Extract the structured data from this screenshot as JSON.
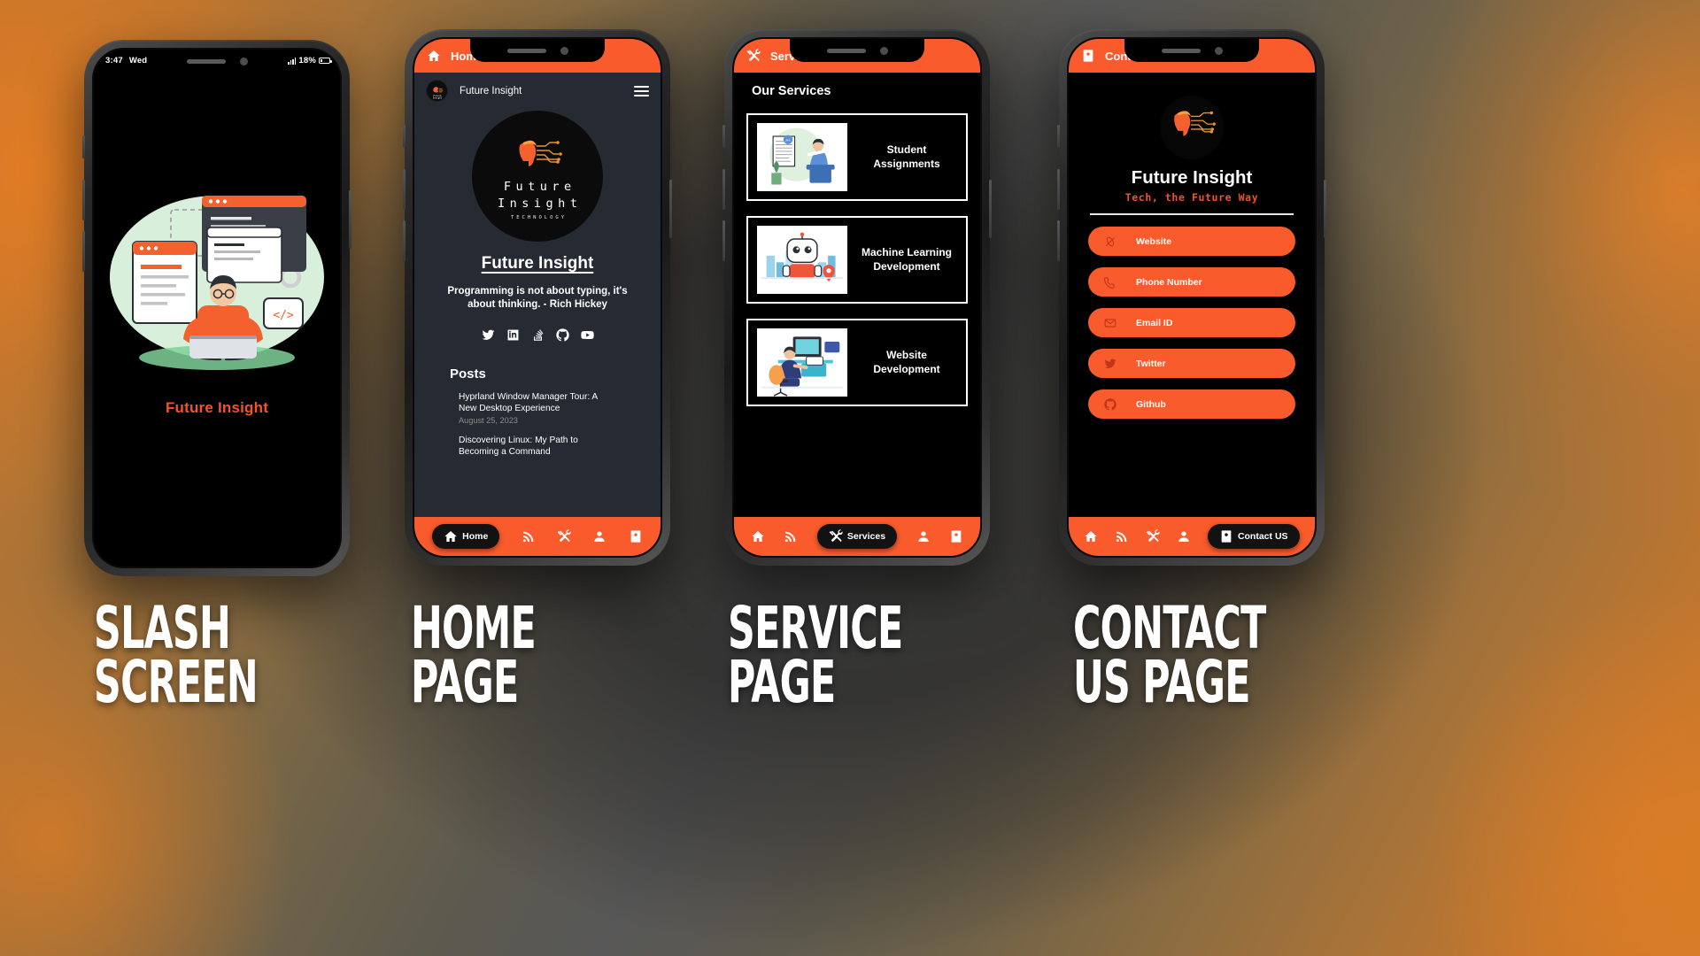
{
  "status_bar": {
    "time": "3:47",
    "day": "Wed",
    "battery": "18%"
  },
  "phones": [
    {
      "id": "splash",
      "screen_label": "Slash Screen",
      "caption": "SLASH\nSCREEN",
      "app_title": "",
      "splash_title": "Future Insight"
    },
    {
      "id": "home",
      "screen_label": "Home Page",
      "caption": "HOME\nPAGE",
      "app_title": "Home",
      "app_icon": "home-icon",
      "account_name": "Future Insight",
      "menu_icon": "hamburger-menu-icon",
      "logo_line1": "Future",
      "logo_line2": "Insight",
      "logo_sub": "TECHNOLOGY",
      "brand_title": "Future Insight",
      "quote": "Programming is not about typing, it's about thinking. - Rich Hickey",
      "socials": [
        "twitter-icon",
        "linkedin-icon",
        "stackoverflow-icon",
        "github-icon",
        "youtube-icon"
      ],
      "posts_heading": "Posts",
      "posts": [
        {
          "title": "Hyprland Window Manager Tour: A New Desktop Experience",
          "date": "August 25, 2023"
        },
        {
          "title": "Discovering Linux: My Path to Becoming a Command",
          "date": ""
        }
      ]
    },
    {
      "id": "services",
      "screen_label": "Service Page",
      "caption": "SERVICE\nPAGE",
      "app_title": "Services",
      "app_icon": "tools-icon",
      "heading": "Our Services",
      "cards": [
        {
          "label": "Student Assignments",
          "thumb": "student-assignment-illustration"
        },
        {
          "label": "Machine Learning Development",
          "thumb": "robot-illustration"
        },
        {
          "label": "Website Development",
          "thumb": "website-dev-illustration"
        }
      ]
    },
    {
      "id": "contact",
      "screen_label": "Contact Us Page",
      "caption": "CONTACT\nUS PAGE",
      "app_title": "Contact US",
      "app_icon": "contact-card-icon",
      "brand_title": "Future Insight",
      "tagline": "Tech, the Future Way",
      "buttons": [
        {
          "label": "Website",
          "icon": "globe-icon"
        },
        {
          "label": "Phone Number",
          "icon": "phone-icon"
        },
        {
          "label": "Email ID",
          "icon": "envelope-icon"
        },
        {
          "label": "Twitter",
          "icon": "twitter-icon"
        },
        {
          "label": "Github",
          "icon": "github-icon"
        }
      ]
    }
  ],
  "bottom_nav": {
    "items": [
      {
        "label": "Home",
        "icon": "home-icon"
      },
      {
        "label": "Feed",
        "icon": "rss-icon"
      },
      {
        "label": "Services",
        "icon": "tools-icon"
      },
      {
        "label": "Profile",
        "icon": "person-icon"
      },
      {
        "label": "Contact US",
        "icon": "contact-card-icon"
      }
    ],
    "active_by_phone": {
      "home": "Home",
      "services": "Services",
      "contact": "Contact US"
    }
  },
  "colors": {
    "accent": "#FA5B2C",
    "accent_text": "#F4532A",
    "screen_dark": "#000000",
    "home_bg": "#262A32",
    "background_orange": "#C9762A"
  }
}
